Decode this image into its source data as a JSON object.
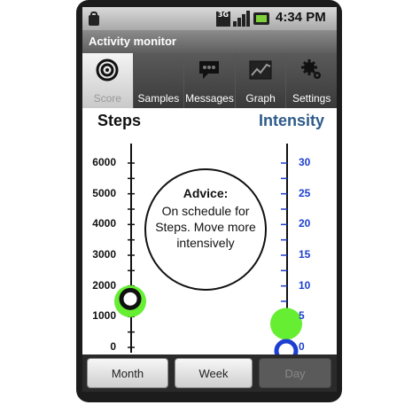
{
  "status_bar": {
    "network_label": "3G",
    "time": "4:34 PM",
    "icons": [
      "storage-icon",
      "3g-icon",
      "signal-icon",
      "battery-icon"
    ]
  },
  "app": {
    "title": "Activity monitor"
  },
  "tabs": [
    {
      "label": "Score",
      "icon": "target-icon",
      "selected": true
    },
    {
      "label": "Samples",
      "icon": "samples-icon",
      "selected": false
    },
    {
      "label": "Messages",
      "icon": "chat-bubble-icon",
      "selected": false
    },
    {
      "label": "Graph",
      "icon": "graph-icon",
      "selected": false
    },
    {
      "label": "Settings",
      "icon": "gears-icon",
      "selected": false
    }
  ],
  "score": {
    "steps_title": "Steps",
    "intensity_title": "Intensity",
    "steps_scale": [
      "6000",
      "5000",
      "4000",
      "3000",
      "2000",
      "1000",
      "0"
    ],
    "intensity_scale": [
      "30",
      "25",
      "20",
      "15",
      "10",
      "5",
      "0"
    ],
    "steps_current": 1000,
    "steps_target": 1500,
    "intensity_current": 0,
    "intensity_target": 5,
    "advice_title": "Advice:",
    "advice_text": "On schedule for Steps. Move more intensively"
  },
  "buttons": {
    "month": "Month",
    "week": "Week",
    "day": "Day"
  },
  "colors": {
    "target_marker": "#66ee33",
    "steps_marker": "#111111",
    "intensity_marker": "#1d3fd0",
    "intensity_title": "#2e5b8a"
  }
}
